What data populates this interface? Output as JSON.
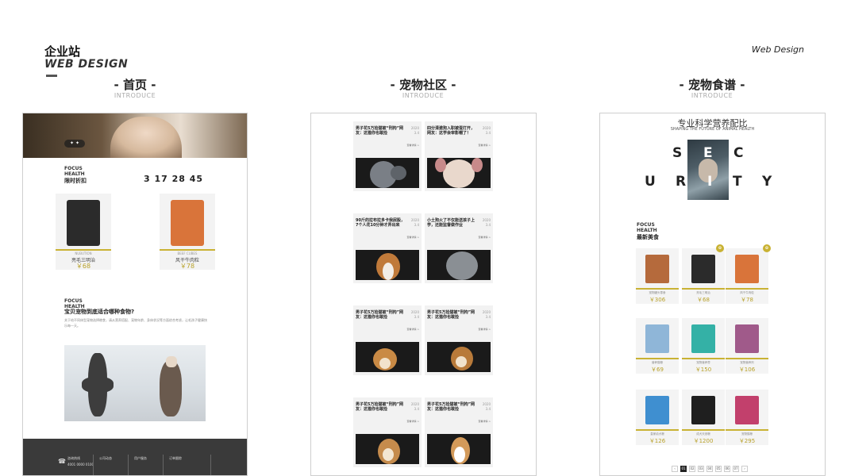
{
  "brand": {
    "cn": "企业站",
    "en": "WEB DESIGN"
  },
  "tagline": "Web Design",
  "sections": [
    {
      "title": "- 首页 -",
      "sub": "INTRODUCE"
    },
    {
      "title": "- 宠物社区 -",
      "sub": "INTRODUCE"
    },
    {
      "title": "- 宠物食谱 -",
      "sub": "INTRODUCE"
    }
  ],
  "home": {
    "focus_en": "FOCUS",
    "health_en": "HEALTH",
    "flash_sale": "限时折扣",
    "countdown": "3 17 28 45",
    "products": [
      {
        "small": "NUBUTION",
        "name": "亮毛三明治",
        "price": "￥68",
        "color": "#2b2b2b"
      },
      {
        "small": "BEEF CUBES",
        "name": "风干牛肉粒",
        "price": "￥78",
        "color": "#d9743a"
      }
    ],
    "article_focus": "FOCUS",
    "article_health": "HEALTH",
    "article_title": "宝贝宠物到底适合哪种食物?",
    "article_body": "关于给不同体型宠物选择粮食，请从营养搭配、宠物年龄、身体状况等方面综合考虑，让毛孩子健康快乐每一天。",
    "footer": {
      "phone_label": "咨询热线",
      "phone": "4001 0000 0100",
      "col1": "公司动态",
      "col2": "用户服务",
      "col3": "订单跟踪"
    }
  },
  "community": {
    "cards": [
      {
        "title": "男子花5万捡猫被“刑拘”网友：这猫你也敢捡",
        "date": "2020\n3.4",
        "more": "查看详情 >",
        "img": "cat"
      },
      {
        "title": "四分清澈狗入职被蛋打开，网友：这学会审影帽了！",
        "date": "2020\n3.4",
        "more": "查看详情 >",
        "img": "chihuahua"
      },
      {
        "title": "90斤的拉布拉多卡我屁股，7个人花10分钟才弄出来",
        "date": "2020\n3.4",
        "more": "查看详情 >",
        "img": "collie"
      },
      {
        "title": "小土狗火了不仅能送孩子上学，还能监督做作业",
        "date": "2020\n3.4",
        "more": "查看详情 >",
        "img": "greycat"
      },
      {
        "title": "男子花5万捡猫被“刑拘”网友：这猫你也敢捡",
        "date": "2020\n3.4",
        "more": "查看详情 >",
        "img": "shiba"
      },
      {
        "title": "男子花5万捡猫被“刑拘”网友：这猫你也敢捡",
        "date": "2020\n3.4",
        "more": "查看详情 >",
        "img": "shiba2"
      },
      {
        "title": "男子花5万捡猫被“刑拘”网友：这猫你也敢捡",
        "date": "2020\n3.4",
        "more": "查看详情 >",
        "img": "shiba3"
      },
      {
        "title": "男子花5万捡猫被“刑拘”网友：这猫你也敢捡",
        "date": "2020\n3.4",
        "more": "查看详情 >",
        "img": "corgi"
      }
    ]
  },
  "recipes": {
    "head": "专业科学营养配比",
    "sub": "SHAPING THE FUTURE OF ANIMAL HEALTH",
    "letters": {
      "s": "S",
      "e": "E",
      "c": "C",
      "u": "U",
      "r": "R",
      "i": "I",
      "t": "T",
      "y": "Y"
    },
    "focus_en": "FOCUS",
    "health_en": "HEALTH",
    "latest": "最新美食",
    "items": [
      {
        "name": "宠物罐头零食",
        "price": "￥306",
        "color": "#b56a3c"
      },
      {
        "name": "亮毛三明治",
        "price": "￥68",
        "color": "#2b2b2b"
      },
      {
        "name": "风干牛肉粒",
        "price": "￥78",
        "color": "#d9743a"
      },
      {
        "name": "营养猫粮",
        "price": "￥69",
        "color": "#8fb6d8"
      },
      {
        "name": "宠物营养膏",
        "price": "￥150",
        "color": "#34b1a6"
      },
      {
        "name": "宠物营养剂",
        "price": "￥106",
        "color": "#a05a8a"
      },
      {
        "name": "皇家幼犬粮",
        "price": "￥126",
        "color": "#3f8fd0"
      },
      {
        "name": "成犬天然粮",
        "price": "￥1200",
        "color": "#1f1f1f"
      },
      {
        "name": "宠物猫粮",
        "price": "￥295",
        "color": "#c2406c"
      }
    ],
    "pages": [
      "‹",
      "01",
      "02",
      "03",
      "04",
      "05",
      "06",
      "07",
      "›"
    ]
  }
}
